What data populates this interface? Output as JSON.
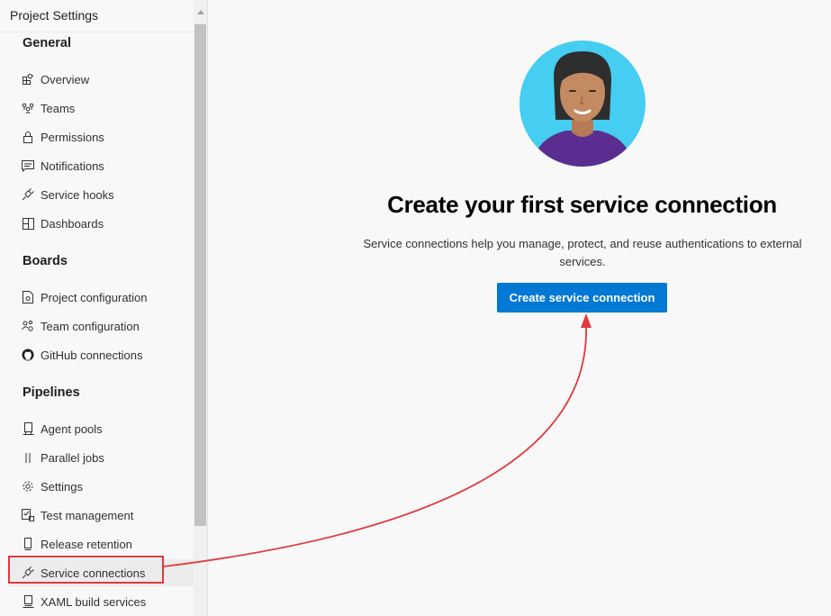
{
  "sidebar": {
    "title": "Project Settings",
    "sections": [
      {
        "header": "General",
        "items": [
          {
            "label": "Overview",
            "icon": "overview-icon"
          },
          {
            "label": "Teams",
            "icon": "teams-icon"
          },
          {
            "label": "Permissions",
            "icon": "lock-icon"
          },
          {
            "label": "Notifications",
            "icon": "chat-icon"
          },
          {
            "label": "Service hooks",
            "icon": "plug-icon"
          },
          {
            "label": "Dashboards",
            "icon": "dashboard-icon"
          }
        ]
      },
      {
        "header": "Boards",
        "items": [
          {
            "label": "Project configuration",
            "icon": "document-gear-icon"
          },
          {
            "label": "Team configuration",
            "icon": "team-gear-icon"
          },
          {
            "label": "GitHub connections",
            "icon": "github-icon"
          }
        ]
      },
      {
        "header": "Pipelines",
        "items": [
          {
            "label": "Agent pools",
            "icon": "server-icon"
          },
          {
            "label": "Parallel jobs",
            "icon": "parallel-icon"
          },
          {
            "label": "Settings",
            "icon": "gear-icon"
          },
          {
            "label": "Test management",
            "icon": "test-icon"
          },
          {
            "label": "Release retention",
            "icon": "phone-icon"
          },
          {
            "label": "Service connections",
            "icon": "plug-icon",
            "selected": true
          },
          {
            "label": "XAML build services",
            "icon": "build-icon"
          }
        ]
      }
    ]
  },
  "main": {
    "heading": "Create your first service connection",
    "description": "Service connections help you manage, protect, and reuse authentications to external services.",
    "button_label": "Create service connection"
  },
  "colors": {
    "accent": "#0078d4",
    "annotation": "#e03a3e",
    "avatar_bg": "#46cdf2",
    "shirt": "#5c2d91"
  }
}
